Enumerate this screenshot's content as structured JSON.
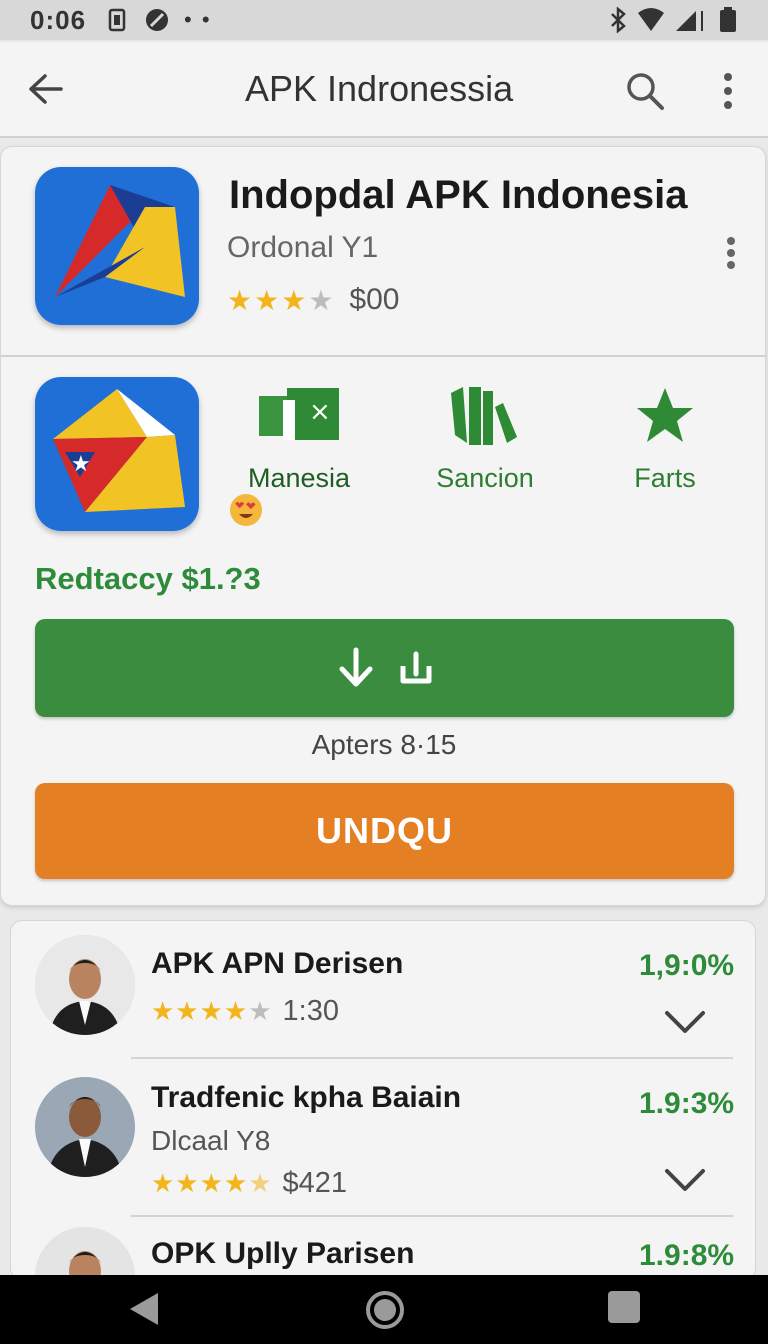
{
  "status_bar": {
    "time": "0:06"
  },
  "app_bar": {
    "title": "APK Indronessia"
  },
  "app": {
    "title": "Indopdal APK Indonesia",
    "subtitle": "Ordonal Y1",
    "rating": 3,
    "rating_max": 5,
    "price": "$00"
  },
  "features": [
    {
      "label": "Manesia",
      "icon": "apk-file-icon"
    },
    {
      "label": "Sancion",
      "icon": "books-icon"
    },
    {
      "label": "Farts",
      "icon": "star-icon"
    }
  ],
  "emoji": "heart-eyes-emoji",
  "price_line": "Redtaccy $1.?3",
  "download_button": {
    "icons": [
      "download-arrow-icon",
      "install-icon"
    ]
  },
  "apters_text": "Apters 8·15",
  "primary_button_label": "UNDQU",
  "list": [
    {
      "title": "APK APN Derisen",
      "subtitle": "",
      "rating": 4.5,
      "rating_text": "1:30",
      "percent": "1,9:0%"
    },
    {
      "title": "Tradfenic kpha Baiain",
      "subtitle": "Dlcaal Y8",
      "rating": 4.5,
      "rating_text": "$421",
      "percent": "1.9:3%"
    },
    {
      "title": "OPK Uplly Parisen",
      "subtitle": "",
      "rating": 0,
      "rating_text": "",
      "percent": "1.9:8%"
    }
  ],
  "colors": {
    "green_primary": "#3a8c3f",
    "green_text": "#2e8b3a",
    "orange_button": "#e47f23",
    "star_gold": "#f2b51c"
  }
}
